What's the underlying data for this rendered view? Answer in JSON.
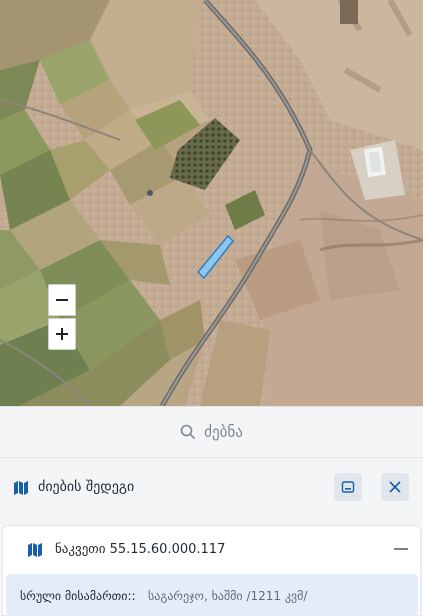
{
  "map": {
    "imagery": "satellite",
    "zoom_controls": {
      "zoom_out_icon": "minus-icon",
      "zoom_in_icon": "plus-icon"
    }
  },
  "search": {
    "placeholder": "ძებნა",
    "icon": "search-icon"
  },
  "results": {
    "title": "ძიების შედეგი",
    "icon": "map-icon",
    "minimize_icon": "minimize-icon",
    "close_icon": "close-icon",
    "items": [
      {
        "label": "ნაკვეთი 55.15.60.000.117",
        "icon": "map-icon",
        "collapse_icon": "minus-icon",
        "address_label": "სრული მისამართი::",
        "address_value": "საგარეჯო, ხაშმი /1211 კვმ/"
      }
    ]
  },
  "colors": {
    "accent": "#1a5fa8",
    "highlight_parcel": "#8ec6ee",
    "panel_bg": "#f4f5f7",
    "address_bg": "#e4edf7"
  }
}
